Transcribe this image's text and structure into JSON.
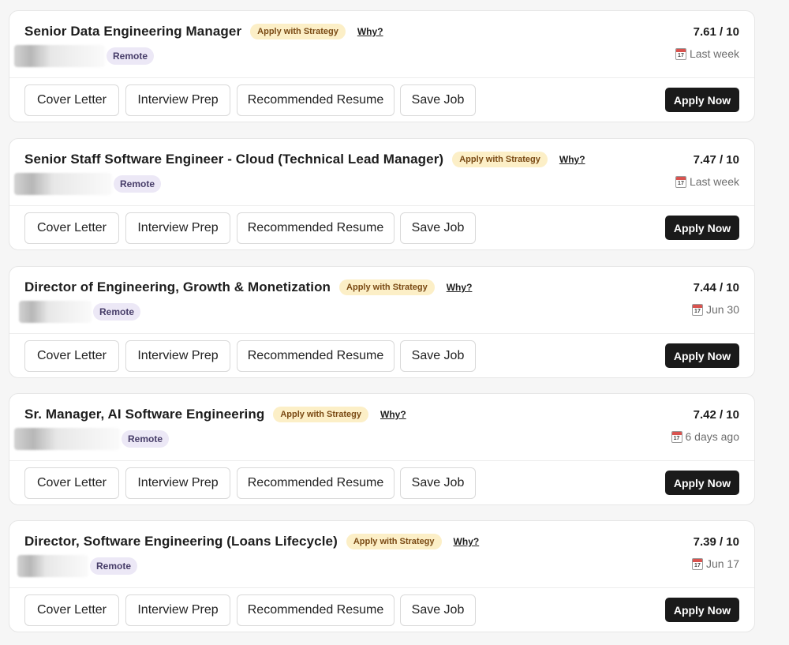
{
  "jobs": [
    {
      "title": "Senior Data Engineering Manager",
      "strategy_badge": "Apply with Strategy",
      "why_link": "Why?",
      "remote_badge": "Remote",
      "score": "7.61 / 10",
      "date": "Last week",
      "actions": {
        "cover_letter": "Cover Letter",
        "interview_prep": "Interview Prep",
        "recommended_resume": "Recommended Resume",
        "save_job": "Save Job",
        "apply_now": "Apply Now"
      }
    },
    {
      "title": "Senior Staff Software Engineer - Cloud (Technical Lead Manager)",
      "strategy_badge": "Apply with Strategy",
      "why_link": "Why?",
      "remote_badge": "Remote",
      "score": "7.47 / 10",
      "date": "Last week",
      "actions": {
        "cover_letter": "Cover Letter",
        "interview_prep": "Interview Prep",
        "recommended_resume": "Recommended Resume",
        "save_job": "Save Job",
        "apply_now": "Apply Now"
      }
    },
    {
      "title": "Director of Engineering, Growth & Monetization",
      "strategy_badge": "Apply with Strategy",
      "why_link": "Why?",
      "remote_badge": "Remote",
      "score": "7.44 / 10",
      "date": "Jun 30",
      "actions": {
        "cover_letter": "Cover Letter",
        "interview_prep": "Interview Prep",
        "recommended_resume": "Recommended Resume",
        "save_job": "Save Job",
        "apply_now": "Apply Now"
      }
    },
    {
      "title": "Sr. Manager, AI Software Engineering",
      "strategy_badge": "Apply with Strategy",
      "why_link": "Why?",
      "remote_badge": "Remote",
      "score": "7.42 / 10",
      "date": "6 days ago",
      "actions": {
        "cover_letter": "Cover Letter",
        "interview_prep": "Interview Prep",
        "recommended_resume": "Recommended Resume",
        "save_job": "Save Job",
        "apply_now": "Apply Now"
      }
    },
    {
      "title": "Director, Software Engineering (Loans Lifecycle)",
      "strategy_badge": "Apply with Strategy",
      "why_link": "Why?",
      "remote_badge": "Remote",
      "score": "7.39 / 10",
      "date": "Jun 17",
      "actions": {
        "cover_letter": "Cover Letter",
        "interview_prep": "Interview Prep",
        "recommended_resume": "Recommended Resume",
        "save_job": "Save Job",
        "apply_now": "Apply Now"
      }
    }
  ],
  "colors": {
    "strategy_badge_bg": "#fcefc7",
    "strategy_badge_text": "#7a4a14",
    "remote_badge_bg": "#ece8f6",
    "apply_button_bg": "#1a1a1a"
  },
  "icons": {
    "date": "calendar-icon"
  }
}
